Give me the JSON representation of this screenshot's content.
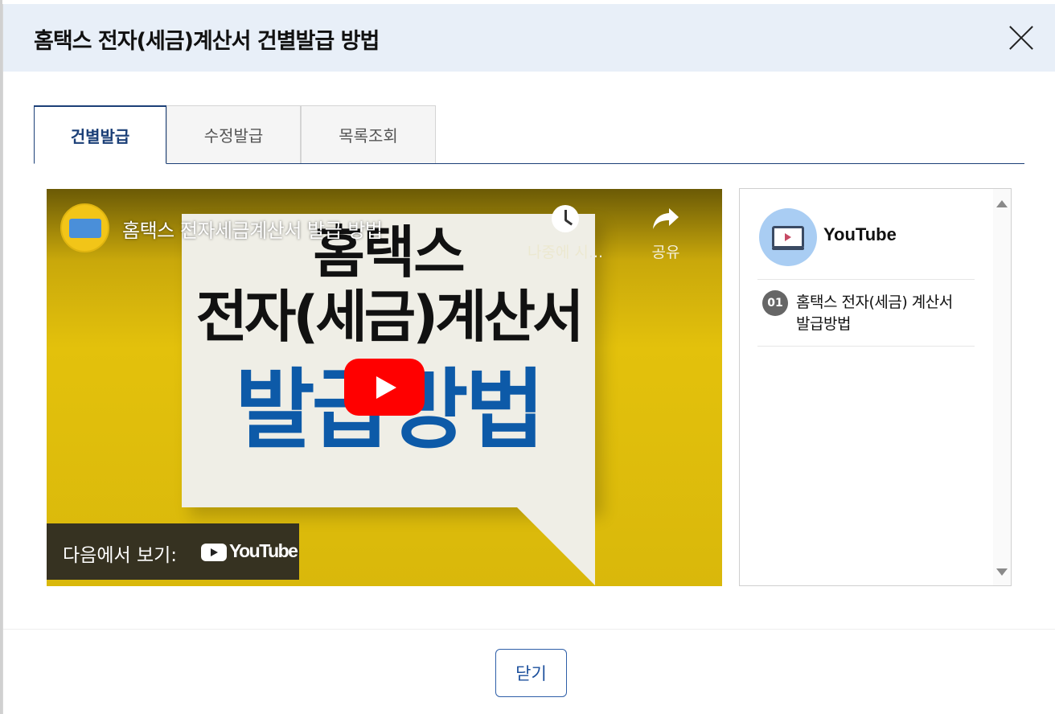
{
  "modal": {
    "title": "홈택스 전자(세금)계산서 건별발급 방법",
    "close_icon": "close-icon"
  },
  "tabs": [
    {
      "label": "건별발급",
      "active": true
    },
    {
      "label": "수정발급",
      "active": false
    },
    {
      "label": "목록조회",
      "active": false
    }
  ],
  "video": {
    "title": "홈택스 전자세금계산서 발급 방법",
    "watch_later_label": "나중에 시...",
    "share_label": "공유",
    "watch_on_label": "다음에서 보기:",
    "youtube_wordmark": "YouTube",
    "thumbnail": {
      "line1": "홈택스",
      "line2": "전자(세금)계산서",
      "line3": "발급방법"
    }
  },
  "sidebar": {
    "brand": "YouTube",
    "items": [
      {
        "num": "01",
        "title": "홈택스 전자(세금) 계산서 발급방법"
      }
    ]
  },
  "footer": {
    "close_label": "닫기"
  },
  "colors": {
    "header_bg": "#e8eff8",
    "accent": "#1b3f77",
    "play_red": "#ff0000",
    "thumb_blue": "#0d5aa8"
  }
}
